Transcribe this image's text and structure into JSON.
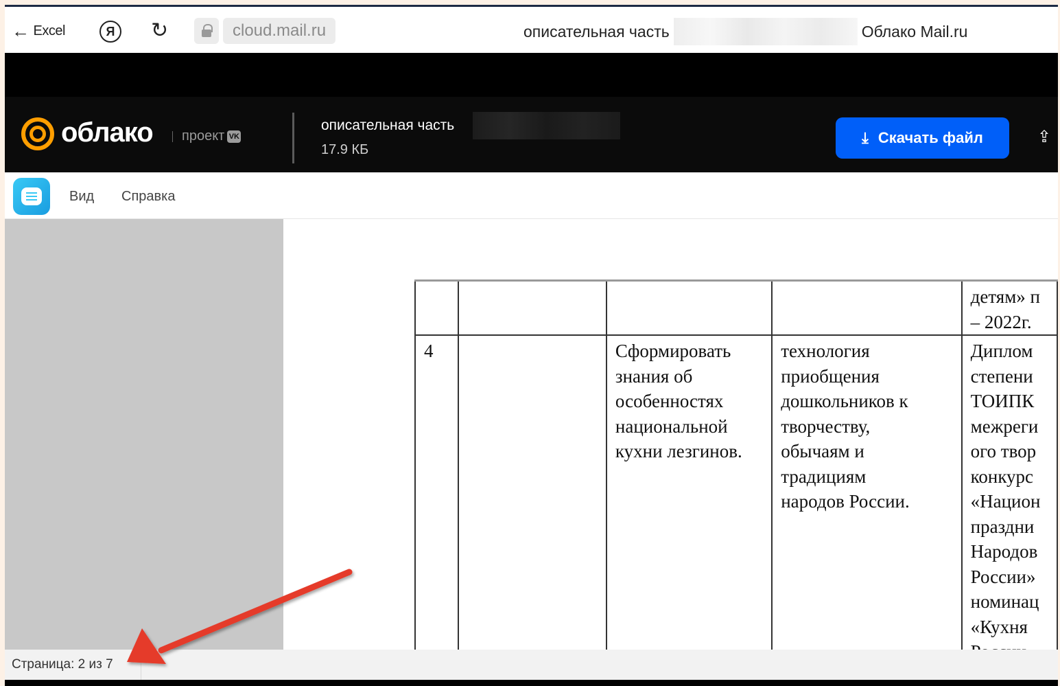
{
  "browser": {
    "back_label": "Excel",
    "yandex_label": "Я",
    "url": "cloud.mail.ru",
    "tab_title": "описательная часть",
    "site_name": "Облако Mail.ru"
  },
  "header": {
    "logo_text": "облако",
    "logo_sub": "проект",
    "vk_badge": "VK",
    "file_name": "описательная часть",
    "file_size": "17.9 КБ",
    "download_label": "Скачать файл"
  },
  "menu": {
    "items": [
      "Вид",
      "Справка"
    ]
  },
  "document": {
    "row_prev": {
      "col5": [
        "детям» п",
        "– 2022г."
      ]
    },
    "row_4": {
      "num": "4",
      "col3": [
        "Сформировать",
        "знания об",
        "особенностях",
        "национальной",
        "кухни лезгинов."
      ],
      "col4": [
        "технология",
        "приобщения",
        "дошкольников к",
        "творчеству,",
        "обычаям и",
        "традициям",
        "народов России."
      ],
      "col5": [
        "Диплом",
        "степени",
        "ТОИПК",
        "межреги",
        "ого твор",
        "конкурс",
        "«Национ",
        "праздни",
        "Народов",
        "России»",
        "номинац",
        "«Кухня",
        "России»"
      ]
    }
  },
  "status": {
    "page_info": "Страница: 2 из 7"
  },
  "colors": {
    "accent_blue": "#005ff9",
    "logo_orange": "#ff9e00",
    "annotation_red": "#e53a2c"
  },
  "icons": {
    "back": "arrow-left-icon",
    "reload": "reload-icon",
    "lock": "lock-icon",
    "download": "download-icon",
    "upload": "cloud-upload-icon",
    "app": "document-app-icon"
  }
}
